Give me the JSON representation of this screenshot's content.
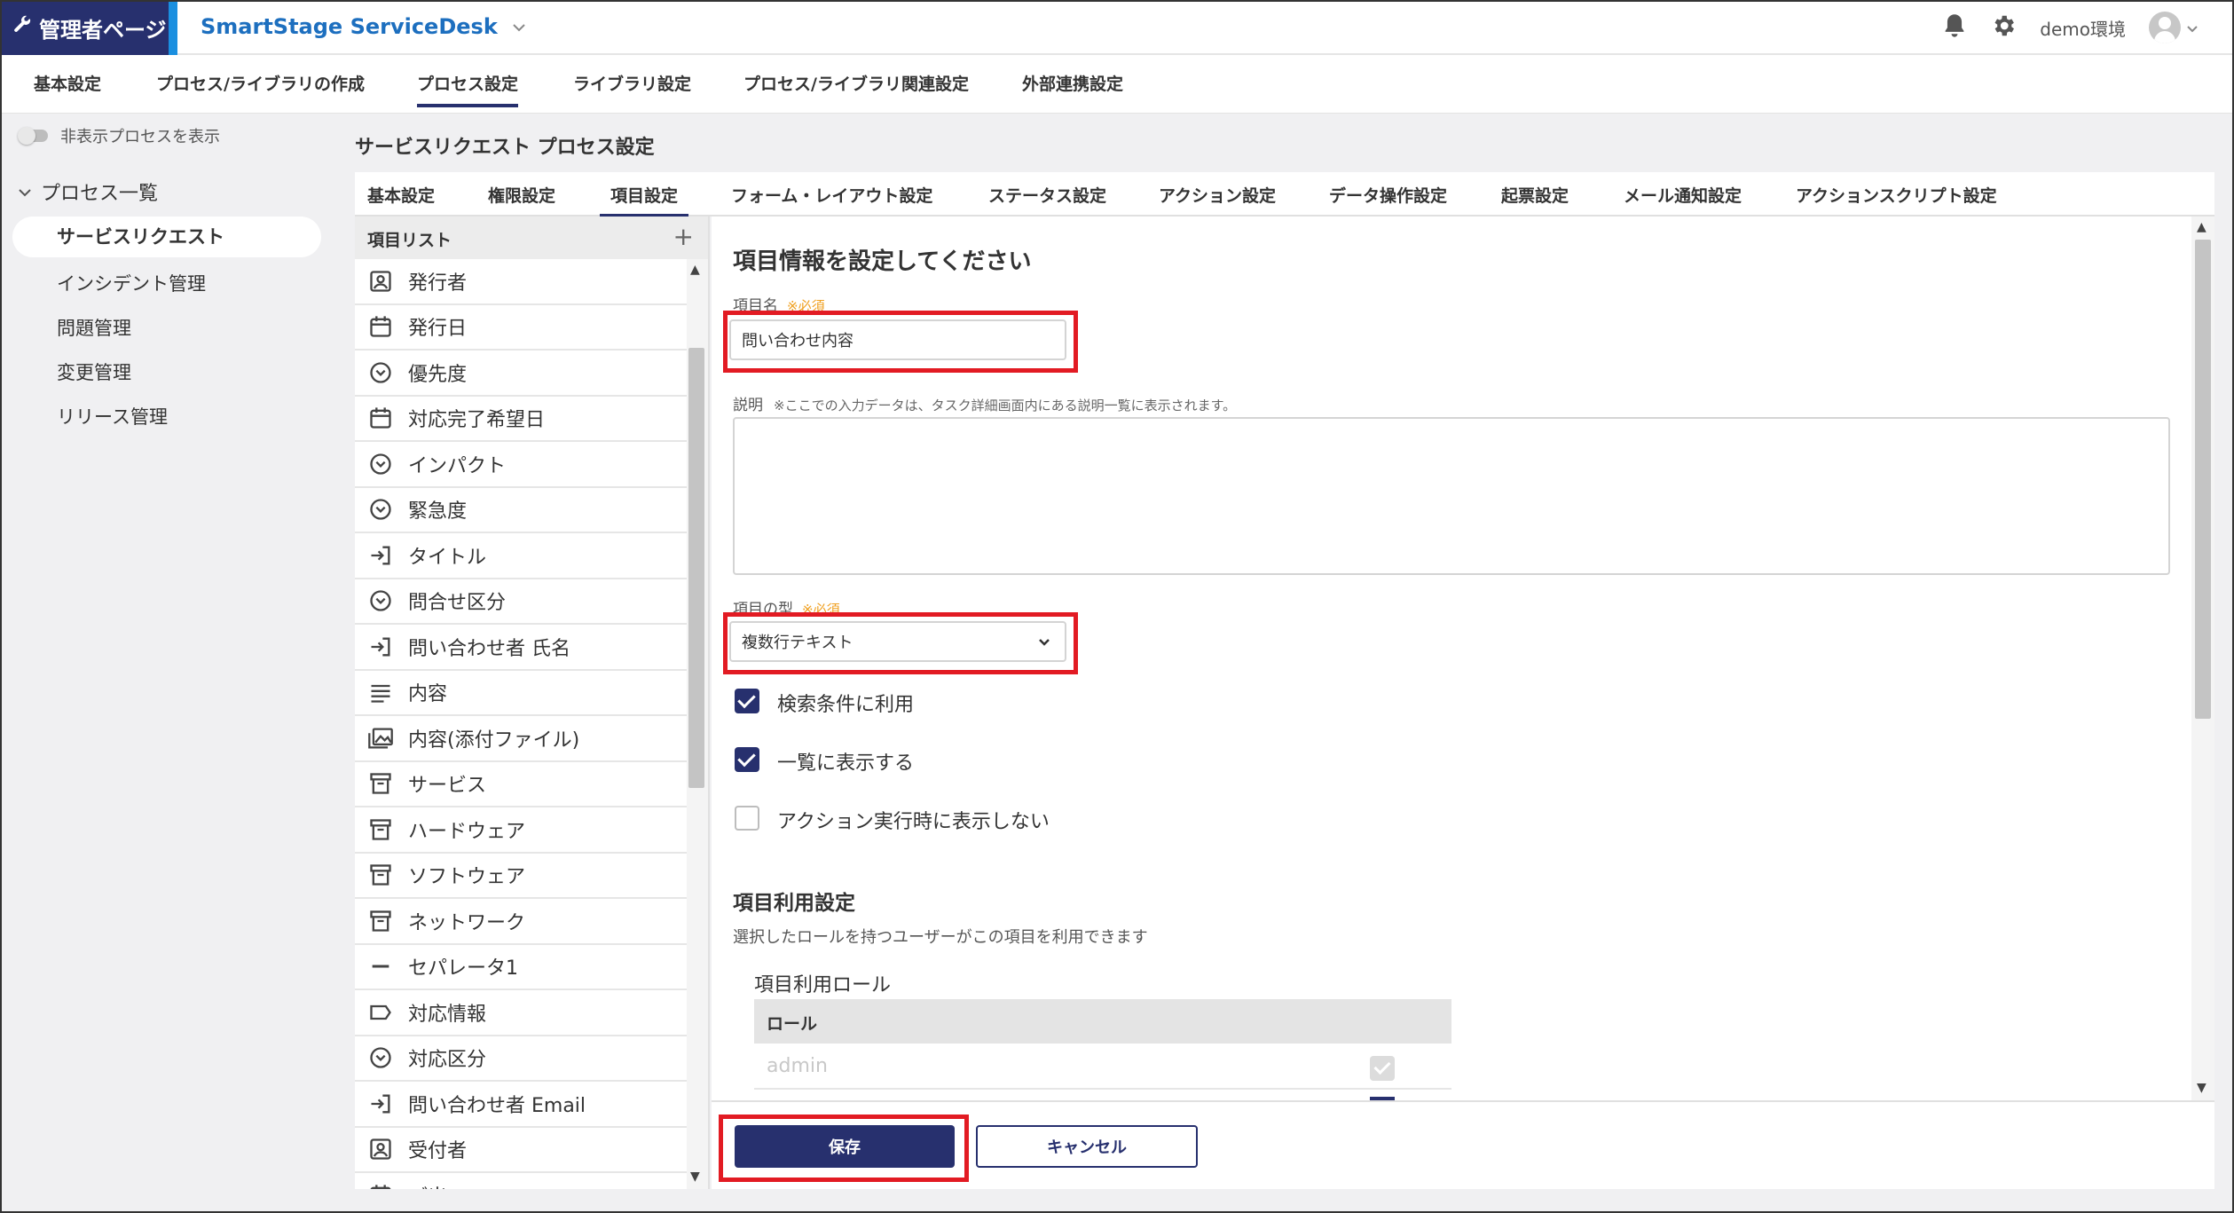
{
  "header": {
    "admin_label": "管理者ページ",
    "app_name": "SmartStage ServiceDesk",
    "env_label": "demo環境"
  },
  "topnav": {
    "tabs": [
      "基本設定",
      "プロセス/ライブラリの作成",
      "プロセス設定",
      "ライブラリ設定",
      "プロセス/ライブラリ関連設定",
      "外部連携設定"
    ],
    "active": "プロセス設定"
  },
  "sidebar": {
    "toggle_label": "非表示プロセスを表示",
    "process_list_label": "プロセス一覧",
    "items": [
      "サービスリクエスト",
      "インシデント管理",
      "問題管理",
      "変更管理",
      "リリース管理"
    ],
    "active": "サービスリクエスト"
  },
  "main": {
    "page_title": "サービスリクエスト プロセス設定",
    "subtabs": [
      "基本設定",
      "権限設定",
      "項目設定",
      "フォーム・レイアウト設定",
      "ステータス設定",
      "アクション設定",
      "データ操作設定",
      "起票設定",
      "メール通知設定",
      "アクションスクリプト設定"
    ],
    "active_subtab": "項目設定"
  },
  "item_list": {
    "header": "項目リスト",
    "add_symbol": "+",
    "items": [
      {
        "label": "発行者",
        "icon": "person-box-icon"
      },
      {
        "label": "発行日",
        "icon": "calendar-icon"
      },
      {
        "label": "優先度",
        "icon": "dropdown-circle-icon"
      },
      {
        "label": "対応完了希望日",
        "icon": "calendar-icon"
      },
      {
        "label": "インパクト",
        "icon": "dropdown-circle-icon"
      },
      {
        "label": "緊急度",
        "icon": "dropdown-circle-icon"
      },
      {
        "label": "タイトル",
        "icon": "input-arrow-icon"
      },
      {
        "label": "問合せ区分",
        "icon": "dropdown-circle-icon"
      },
      {
        "label": "問い合わせ者 氏名",
        "icon": "input-arrow-icon"
      },
      {
        "label": "内容",
        "icon": "multiline-text-icon"
      },
      {
        "label": "内容(添付ファイル)",
        "icon": "image-gallery-icon"
      },
      {
        "label": "サービス",
        "icon": "archive-box-icon"
      },
      {
        "label": "ハードウェア",
        "icon": "archive-box-icon"
      },
      {
        "label": "ソフトウェア",
        "icon": "archive-box-icon"
      },
      {
        "label": "ネットワーク",
        "icon": "archive-box-icon"
      },
      {
        "label": "セパレータ1",
        "icon": "separator-line-icon"
      },
      {
        "label": "対応情報",
        "icon": "label-tag-icon"
      },
      {
        "label": "対応区分",
        "icon": "dropdown-circle-icon"
      },
      {
        "label": "問い合わせ者 Email",
        "icon": "input-arrow-icon"
      },
      {
        "label": "受付者",
        "icon": "person-box-icon"
      },
      {
        "label": "ご出...",
        "icon": "calendar-icon"
      }
    ]
  },
  "form": {
    "title": "項目情報を設定してください",
    "name_label": "項目名",
    "required_mark": "※必須",
    "name_value": "問い合わせ内容",
    "desc_label": "説明",
    "desc_hint": "※ここでの入力データは、タスク詳細画面内にある説明一覧に表示されます。",
    "type_label": "項目の型",
    "type_value": "複数行テキスト",
    "checkboxes": [
      {
        "label": "検索条件に利用",
        "checked": true
      },
      {
        "label": "一覧に表示する",
        "checked": true
      },
      {
        "label": "アクション実行時に表示しない",
        "checked": false
      }
    ],
    "usage_title": "項目利用設定",
    "usage_desc": "選択したロールを持つユーザーがこの項目を利用できます",
    "role_title": "項目利用ロール",
    "role_header": "ロール",
    "roles": [
      "admin"
    ]
  },
  "buttons": {
    "save": "保存",
    "cancel": "キャンセル"
  },
  "colors": {
    "primary": "#27306e",
    "brand_blue": "#1a8fe0",
    "highlight_red": "#e21b23"
  }
}
